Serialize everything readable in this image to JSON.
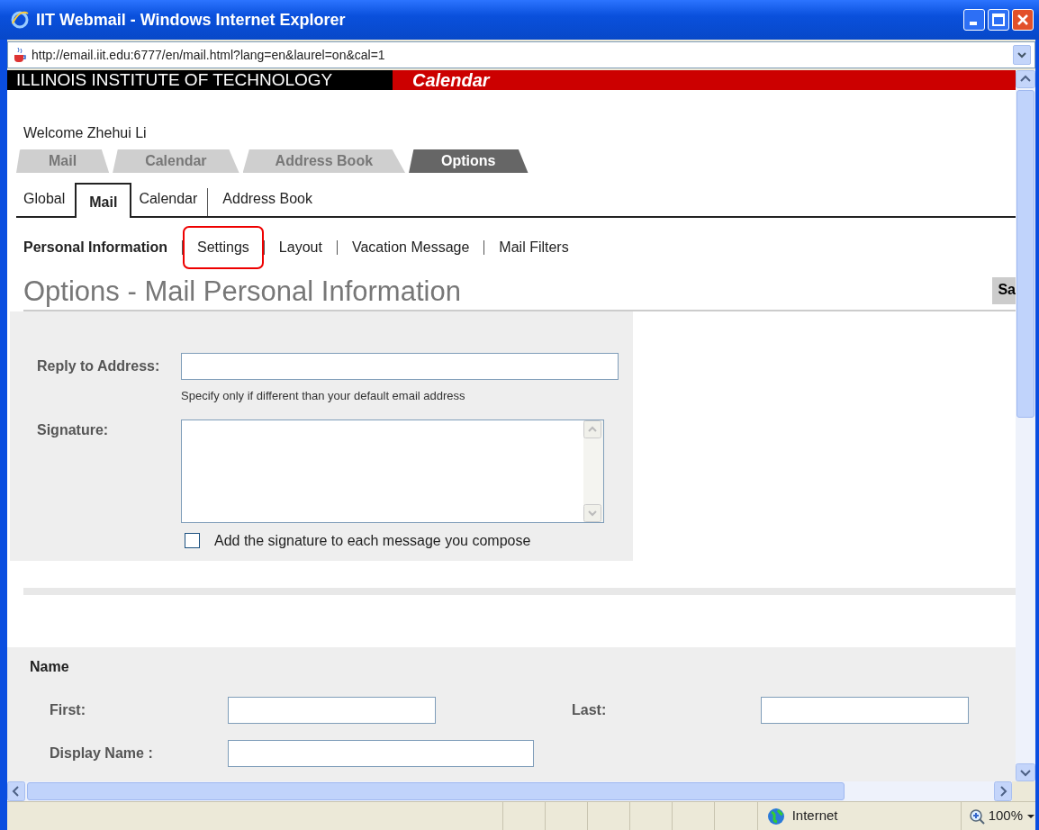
{
  "window": {
    "title": "IIT Webmail - Windows Internet Explorer"
  },
  "address_bar": {
    "url": "http://email.iit.edu:6777/en/mail.html?lang=en&laurel=on&cal=1"
  },
  "banner": {
    "institution": "ILLINOIS INSTITUTE OF TECHNOLOGY",
    "app": "Calendar"
  },
  "welcome": "Welcome Zhehui Li",
  "main_tabs": [
    {
      "label": "Mail",
      "selected": false
    },
    {
      "label": "Calendar",
      "selected": false
    },
    {
      "label": "Address Book",
      "selected": false
    },
    {
      "label": "Options",
      "selected": true
    }
  ],
  "sub_tabs": [
    {
      "label": "Global",
      "selected": false
    },
    {
      "label": "Mail",
      "selected": true
    },
    {
      "label": "Calendar",
      "selected": false
    },
    {
      "label": "Address Book",
      "selected": false
    }
  ],
  "section_links": [
    {
      "label": "Personal Information",
      "selected": true,
      "highlighted": false
    },
    {
      "label": "Settings",
      "selected": false,
      "highlighted": true
    },
    {
      "label": "Layout",
      "selected": false,
      "highlighted": false
    },
    {
      "label": "Vacation Message",
      "selected": false,
      "highlighted": false
    },
    {
      "label": "Mail Filters",
      "selected": false,
      "highlighted": false
    }
  ],
  "page_title": "Options - Mail Personal Information",
  "save_button": "Sa",
  "personal_form": {
    "reply_label": "Reply to Address:",
    "reply_hint": "Specify only if different than your default email address",
    "signature_label": "Signature:",
    "signature_checkbox": {
      "label": "Add the signature to each message you compose",
      "checked": false
    }
  },
  "name_section": {
    "heading": "Name",
    "fields": [
      {
        "label": "First:"
      },
      {
        "label": "Last:"
      },
      {
        "label": "Display Name :"
      }
    ]
  },
  "status_bar": {
    "zone": "Internet",
    "zoom": "100%"
  }
}
